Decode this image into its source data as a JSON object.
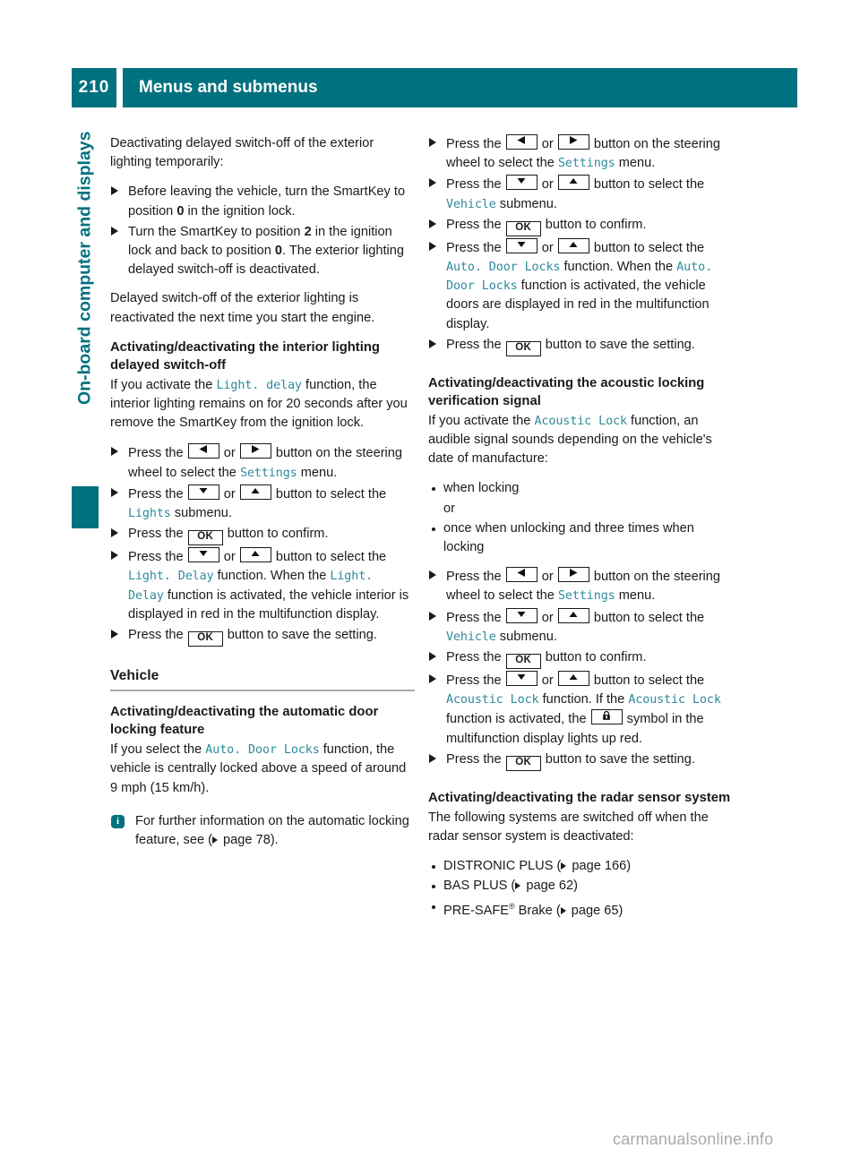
{
  "header": {
    "page_number": "210",
    "title": "Menus and submenus"
  },
  "sidebar": {
    "chapter_label": "On-board computer and displays"
  },
  "keys": {
    "left": "◀",
    "right": "▶",
    "down": "▼",
    "up": "▲",
    "ok": "OK",
    "lock": "🔒"
  },
  "left_column": {
    "intro": {
      "line1": "Deactivating delayed switch-off of the",
      "line2": "exterior lighting temporarily:"
    },
    "steps_exterior": [
      {
        "pre": "Before leaving the vehicle, turn the SmartKey to position ",
        "bold": "0",
        "post": " in the ignition lock."
      },
      {
        "pre": "Turn the SmartKey to position ",
        "bold": "2",
        "mid": " in the ignition lock and back to position ",
        "bold2": "0",
        "post": ".",
        "extra": "The exterior lighting delayed switch-off is deactivated."
      }
    ],
    "reactivated_note": "Delayed switch-off of the exterior lighting is reactivated the next time you start the engine.",
    "interior_heading": "Activating/deactivating the interior lighting delayed switch-off",
    "interior_intro": {
      "pre": "If you activate the ",
      "token": "Light. delay",
      "post": " function, the interior lighting remains on for 20 seconds after you remove the SmartKey from the ignition lock."
    },
    "interior_steps": {
      "step1_pre": "Press the ",
      "step1_or": " or ",
      "step1_post": " button on the steering wheel to select the ",
      "step1_token": "Settings",
      "step1_tail": " menu.",
      "step2_pre": "Press the ",
      "step2_or": " or ",
      "step2_post": " button to select the ",
      "step2_token": "Lights",
      "step2_tail": " submenu.",
      "step3_pre": "Press the ",
      "step3_post": " button to confirm.",
      "step4_pre": "Press the ",
      "step4_or": " or ",
      "step4_post": " button to select the ",
      "step4_token": "Light. Delay",
      "step4_tail": " function.",
      "step4_extra_pre": "When the ",
      "step4_extra_token": "Light. Delay",
      "step4_extra_post": " function is activated, the vehicle interior is displayed in red in the multifunction display.",
      "step5_pre": "Press the ",
      "step5_post": " button to save the setting."
    },
    "vehicle_section_heading": "Vehicle",
    "auto_door_heading": "Activating/deactivating the automatic door locking feature",
    "auto_door_intro": {
      "pre": "If you select the ",
      "token": "Auto. Door Locks",
      "post": " function, the vehicle is centrally locked above a speed of around 9 mph (15 km/h)."
    },
    "note": {
      "icon": "i",
      "pre": "For further information on the automatic locking feature, see (",
      "page": " page 78",
      "post": ")."
    }
  },
  "right_column": {
    "auto_door_steps": {
      "step1_pre": "Press the ",
      "step1_or": " or ",
      "step1_post": " button on the steering wheel to select the ",
      "step1_token": "Settings",
      "step1_tail": " menu.",
      "step2_pre": "Press the ",
      "step2_or": " or ",
      "step2_post": " button to select the ",
      "step2_token": "Vehicle",
      "step2_tail": " submenu.",
      "step3_pre": "Press the ",
      "step3_post": " button to confirm.",
      "step4_pre": "Press the ",
      "step4_or": " or ",
      "step4_post": " button to select the ",
      "step4_token": "Auto. Door Locks",
      "step4_tail": " function.",
      "step4_extra_pre": "When the ",
      "step4_extra_token": "Auto. Door Locks",
      "step4_extra_post": " function is activated, the vehicle doors are displayed in red in the multifunction display.",
      "step5_pre": "Press the ",
      "step5_post": " button to save the setting."
    },
    "acoustic_heading": "Activating/deactivating the acoustic locking verification signal",
    "acoustic_intro": {
      "pre": "If you activate the ",
      "token": "Acoustic Lock",
      "post": " function, an audible signal sounds depending on the vehicle's date of manufacture:"
    },
    "acoustic_bullets": {
      "item1": "when locking",
      "or": "or",
      "item2": "once when unlocking and three times when locking"
    },
    "acoustic_steps": {
      "step1_pre": "Press the ",
      "step1_or": " or ",
      "step1_post": " button on the steering wheel to select the ",
      "step1_token": "Settings",
      "step1_tail": " menu.",
      "step2_pre": "Press the ",
      "step2_or": " or ",
      "step2_post": " button to select the ",
      "step2_token": "Vehicle",
      "step2_tail": " submenu.",
      "step3_pre": "Press the ",
      "step3_post": " button to confirm.",
      "step4_pre": "Press the ",
      "step4_or": " or ",
      "step4_post": " button to select the ",
      "step4_token": "Acoustic Lock",
      "step4_tail": " function.",
      "step4_extra_pre": "If the ",
      "step4_extra_token": "Acoustic Lock",
      "step4_extra_mid": " function is activated, the ",
      "step4_extra_post": " symbol in the multifunction display lights up red.",
      "step5_pre": "Press the ",
      "step5_post": " button to save the setting."
    },
    "radar_heading": "Activating/deactivating the radar sensor system",
    "radar_intro": "The following systems are switched off when the radar sensor system is deactivated:",
    "radar_bullets": [
      {
        "label": "DISTRONIC PLUS (",
        "page": " page 166",
        "tail": ")"
      },
      {
        "label": "BAS PLUS (",
        "page": " page 62",
        "tail": ")"
      },
      {
        "label": "PRE-SAFE",
        "reg": "®",
        "label2": " Brake (",
        "page": " page 65",
        "tail": ")"
      }
    ]
  },
  "watermark": "carmanualsonline.info"
}
